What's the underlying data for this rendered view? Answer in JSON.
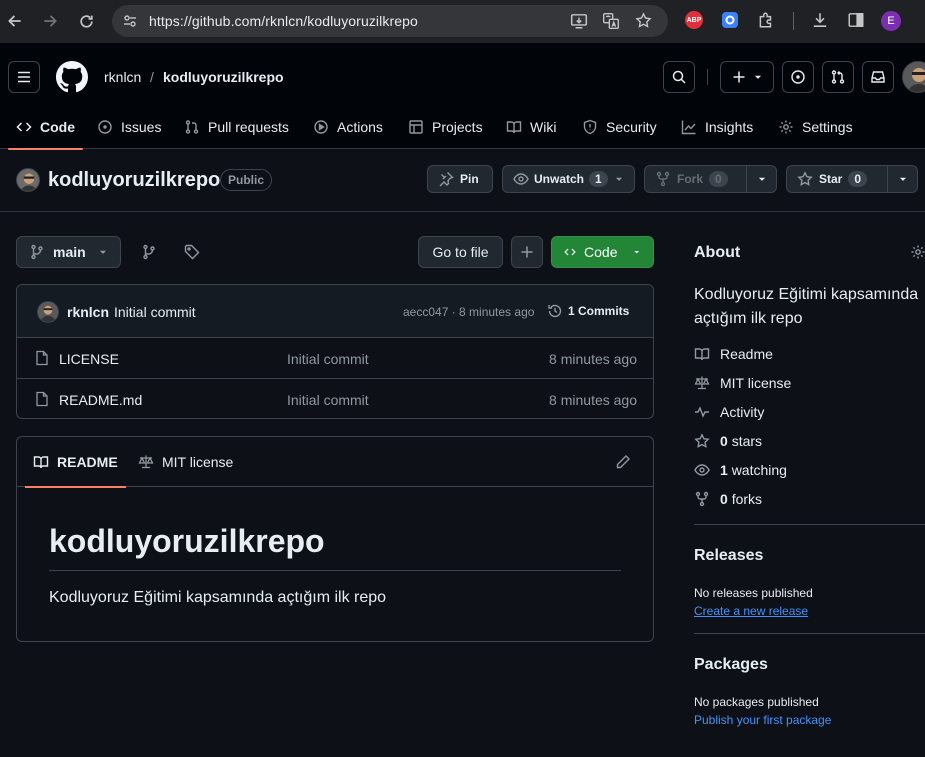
{
  "browser": {
    "url": "https://github.com/rknlcn/kodluyoruzilkrepo",
    "abp_label": "ABP",
    "profile_initial": "E"
  },
  "header": {
    "owner": "rknlcn",
    "separator": "/",
    "repo": "kodluyoruzilkrepo"
  },
  "tabs": [
    {
      "label": "Code"
    },
    {
      "label": "Issues"
    },
    {
      "label": "Pull requests"
    },
    {
      "label": "Actions"
    },
    {
      "label": "Projects"
    },
    {
      "label": "Wiki"
    },
    {
      "label": "Security"
    },
    {
      "label": "Insights"
    },
    {
      "label": "Settings"
    }
  ],
  "repo": {
    "name": "kodluyoruzilkrepo",
    "visibility": "Public",
    "pin_label": "Pin",
    "unwatch_label": "Unwatch",
    "watch_count": "1",
    "fork_label": "Fork",
    "fork_count": "0",
    "star_label": "Star",
    "star_count": "0"
  },
  "branch": {
    "name": "main",
    "goto_label": "Go to file",
    "code_label": "Code"
  },
  "commit": {
    "author": "rknlcn",
    "message": "Initial commit",
    "sha_time": "aecc047 · 8 minutes ago",
    "commits_label": "1 Commits"
  },
  "files": [
    {
      "name": "LICENSE",
      "message": "Initial commit",
      "age": "8 minutes ago"
    },
    {
      "name": "README.md",
      "message": "Initial commit",
      "age": "8 minutes ago"
    }
  ],
  "readme": {
    "tab_readme": "README",
    "tab_license": "MIT license",
    "heading": "kodluyoruzilkrepo",
    "body": "Kodluyoruz Eğitimi kapsamında açtığım ilk repo"
  },
  "about": {
    "title": "About",
    "description": "Kodluyoruz Eğitimi kapsamında açtığım ilk repo",
    "readme": "Readme",
    "license": "MIT license",
    "activity": "Activity",
    "stars_count": "0",
    "stars_label": "stars",
    "watching_count": "1",
    "watching_label": "watching",
    "forks_count": "0",
    "forks_label": "forks"
  },
  "releases": {
    "title": "Releases",
    "empty": "No releases published",
    "create_link": "Create a new release"
  },
  "packages": {
    "title": "Packages",
    "empty": "No packages published",
    "publish_link": "Publish your first package"
  },
  "colors": {
    "bg": "#0d1117",
    "header_bg": "#010409",
    "accent_underline": "#f78166",
    "code_button": "#238636",
    "link": "#4493f8"
  }
}
